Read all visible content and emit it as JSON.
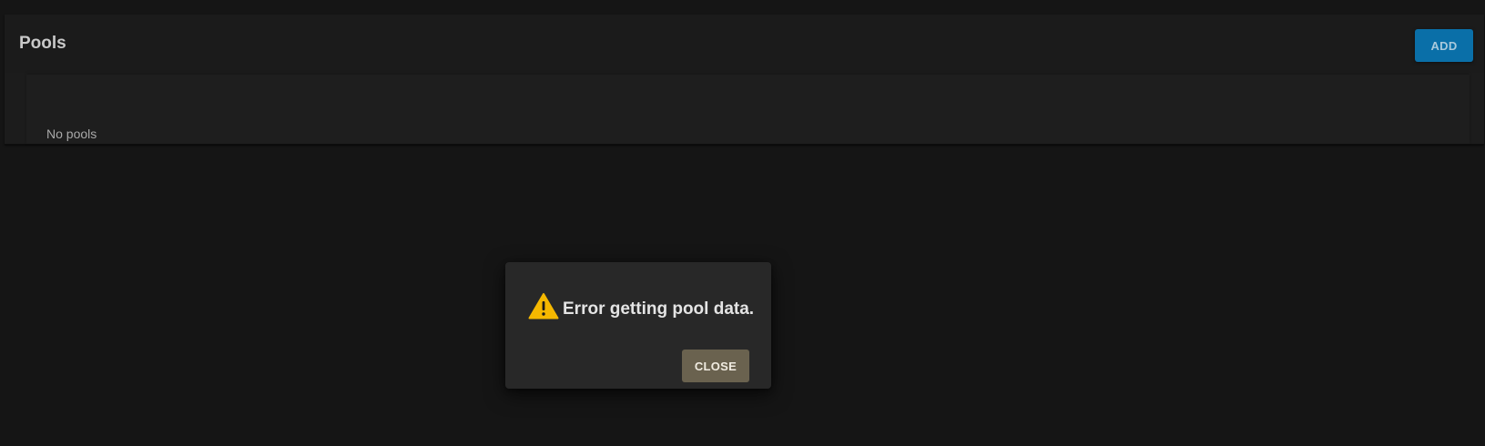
{
  "pools_card": {
    "title": "Pools",
    "add_label": "ADD",
    "empty_text": "No pools"
  },
  "dialog": {
    "icon": "warning-icon",
    "message": "Error getting pool data.",
    "close_label": "CLOSE"
  },
  "colors": {
    "background": "#151515",
    "card": "#1c1c1c",
    "accent_button": "#0a6fa8",
    "dialog": "#282828",
    "close_button": "#6a624f",
    "warning": "#f5b800"
  }
}
